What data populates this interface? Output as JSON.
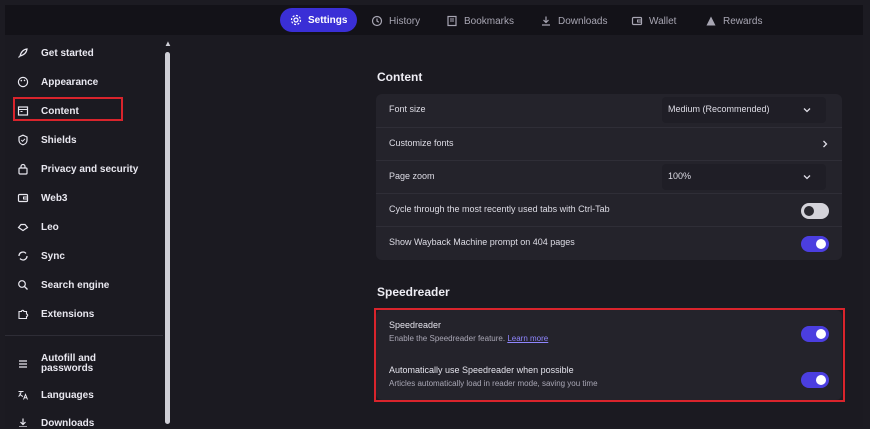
{
  "topnav": {
    "tabs": [
      {
        "label": "Settings",
        "icon": "gear-icon",
        "active": true
      },
      {
        "label": "History",
        "icon": "history-icon",
        "active": false
      },
      {
        "label": "Bookmarks",
        "icon": "bookmark-icon",
        "active": false
      },
      {
        "label": "Downloads",
        "icon": "download-icon",
        "active": false
      },
      {
        "label": "Wallet",
        "icon": "wallet-icon",
        "active": false
      },
      {
        "label": "Rewards",
        "icon": "rewards-icon",
        "active": false
      }
    ]
  },
  "sidebar": {
    "items": [
      {
        "label": "Get started",
        "icon": "rocket-icon"
      },
      {
        "label": "Appearance",
        "icon": "palette-icon"
      },
      {
        "label": "Content",
        "icon": "content-icon"
      },
      {
        "label": "Shields",
        "icon": "shield-icon"
      },
      {
        "label": "Privacy and security",
        "icon": "lock-icon"
      },
      {
        "label": "Web3",
        "icon": "wallet-icon"
      },
      {
        "label": "Leo",
        "icon": "leo-icon"
      },
      {
        "label": "Sync",
        "icon": "sync-icon"
      },
      {
        "label": "Search engine",
        "icon": "search-icon"
      },
      {
        "label": "Extensions",
        "icon": "puzzle-icon"
      },
      {
        "label": "Autofill and\npasswords",
        "icon": "list-icon"
      },
      {
        "label": "Languages",
        "icon": "language-icon"
      },
      {
        "label": "Downloads",
        "icon": "download-icon"
      }
    ]
  },
  "content": {
    "title": "Content",
    "font_size": {
      "label": "Font size",
      "value": "Medium (Recommended)"
    },
    "customize_fonts": {
      "label": "Customize fonts"
    },
    "page_zoom": {
      "label": "Page zoom",
      "value": "100%"
    },
    "cycle_tabs": {
      "label": "Cycle through the most recently used tabs with Ctrl-Tab",
      "enabled": false
    },
    "wayback": {
      "label": "Show Wayback Machine prompt on 404 pages",
      "enabled": true
    }
  },
  "speedreader": {
    "title": "Speedreader",
    "main": {
      "title": "Speedreader",
      "subtitle": "Enable the Speedreader feature.",
      "link": "Learn more",
      "enabled": true
    },
    "auto": {
      "title": "Automatically use Speedreader when possible",
      "subtitle": "Articles automatically load in reader mode, saving you time",
      "enabled": true
    }
  },
  "colors": {
    "accent": "#4b3ee0",
    "highlight": "#d9242c",
    "background": "#1b1a21"
  }
}
